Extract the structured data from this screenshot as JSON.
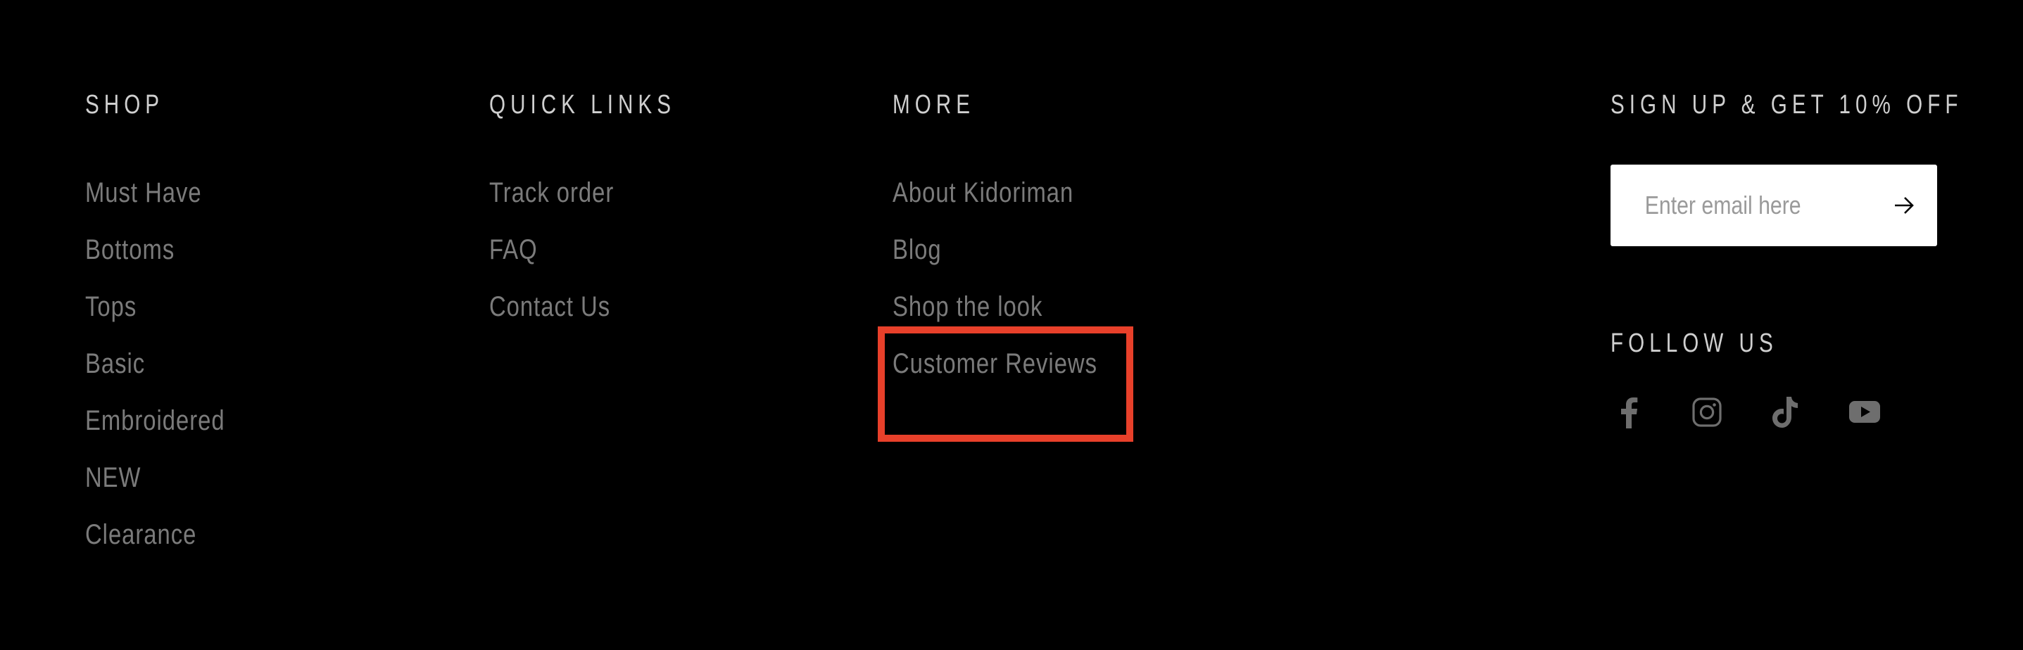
{
  "colors": {
    "background": "#000000",
    "heading": "#cfcfcf",
    "link": "#7b7b7b",
    "icon": "#6e6e6e",
    "input_bg": "#ffffff",
    "placeholder": "#9a9a9a",
    "highlight": "#e8402a"
  },
  "shop": {
    "heading": "SHOP",
    "items": [
      {
        "label": "Must Have"
      },
      {
        "label": "Bottoms"
      },
      {
        "label": "Tops"
      },
      {
        "label": "Basic"
      },
      {
        "label": "Embroidered"
      },
      {
        "label": "NEW"
      },
      {
        "label": "Clearance"
      }
    ]
  },
  "quick_links": {
    "heading": "QUICK LINKS",
    "items": [
      {
        "label": "Track order"
      },
      {
        "label": "FAQ"
      },
      {
        "label": "Contact Us"
      }
    ]
  },
  "more": {
    "heading": "MORE",
    "items": [
      {
        "label": "About Kidoriman"
      },
      {
        "label": "Blog"
      },
      {
        "label": "Shop the look"
      },
      {
        "label": "Customer Reviews",
        "highlighted": true
      }
    ]
  },
  "signup": {
    "heading": "SIGN UP & GET 10% OFF",
    "email_placeholder": "Enter email here",
    "email_value": "",
    "submit_icon": "arrow-right-icon"
  },
  "follow": {
    "heading": "FOLLOW US",
    "socials": [
      {
        "name": "facebook",
        "icon": "facebook-icon"
      },
      {
        "name": "instagram",
        "icon": "instagram-icon"
      },
      {
        "name": "tiktok",
        "icon": "tiktok-icon"
      },
      {
        "name": "youtube",
        "icon": "youtube-icon"
      }
    ]
  }
}
